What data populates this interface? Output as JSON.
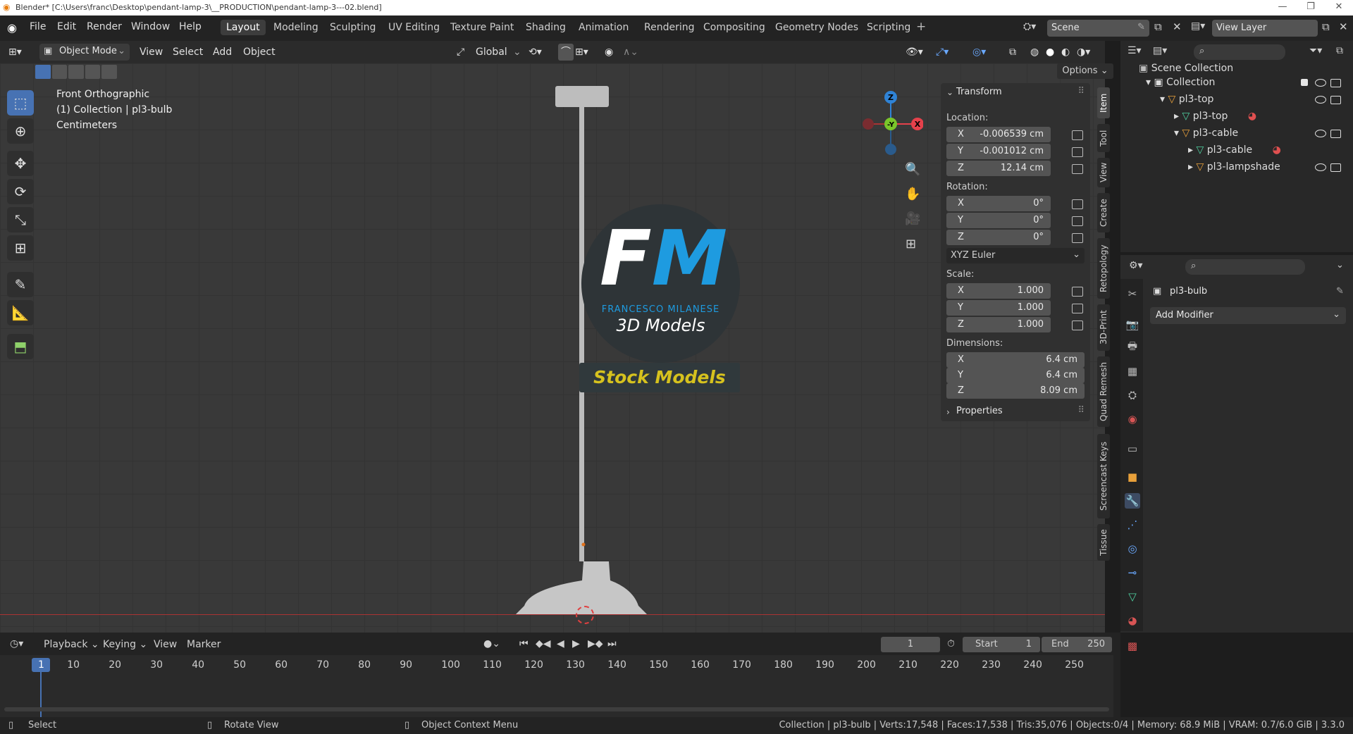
{
  "titlebar": {
    "title": "Blender* [C:\\Users\\franc\\Desktop\\pendant-lamp-3\\__PRODUCTION\\pendant-lamp-3---02.blend]"
  },
  "menu": [
    "File",
    "Edit",
    "Render",
    "Window",
    "Help"
  ],
  "workspaces": [
    "Layout",
    "Modeling",
    "Sculpting",
    "UV Editing",
    "Texture Paint",
    "Shading",
    "Animation",
    "Rendering",
    "Compositing",
    "Geometry Nodes",
    "Scripting"
  ],
  "active_workspace": "Layout",
  "scene": {
    "name": "Scene",
    "view_layer": "View Layer"
  },
  "header": {
    "mode": "Object Mode",
    "view": "View",
    "select": "Select",
    "add": "Add",
    "object": "Object",
    "orientation": "Global",
    "options": "Options"
  },
  "viewport": {
    "view_name": "Front Orthographic",
    "collection": "(1) Collection | pl3-bulb",
    "units": "Centimeters"
  },
  "watermark": {
    "brand": "FM",
    "name": "FRANCESCO MILANESE",
    "line2": "3D Models",
    "banner": "Stock Models"
  },
  "npanel": {
    "transform_title": "Transform",
    "location_label": "Location:",
    "location": [
      {
        "axis": "X",
        "value": "-0.006539 cm"
      },
      {
        "axis": "Y",
        "value": "-0.001012 cm"
      },
      {
        "axis": "Z",
        "value": "12.14 cm"
      }
    ],
    "rotation_label": "Rotation:",
    "rotation": [
      {
        "axis": "X",
        "value": "0°"
      },
      {
        "axis": "Y",
        "value": "0°"
      },
      {
        "axis": "Z",
        "value": "0°"
      }
    ],
    "rotation_mode": "XYZ Euler",
    "scale_label": "Scale:",
    "scale": [
      {
        "axis": "X",
        "value": "1.000"
      },
      {
        "axis": "Y",
        "value": "1.000"
      },
      {
        "axis": "Z",
        "value": "1.000"
      }
    ],
    "dimensions_label": "Dimensions:",
    "dimensions": [
      {
        "axis": "X",
        "value": "6.4 cm"
      },
      {
        "axis": "Y",
        "value": "6.4 cm"
      },
      {
        "axis": "Z",
        "value": "8.09 cm"
      }
    ],
    "properties_label": "Properties"
  },
  "side_tabs": [
    "Item",
    "Tool",
    "View",
    "Create",
    "Retopology",
    "3D-Print",
    "Quad Remesh",
    "Screencast Keys",
    "Tissue"
  ],
  "outliner": {
    "root": "Scene Collection",
    "items": [
      {
        "label": "Collection"
      },
      {
        "label": "pl3-top"
      },
      {
        "label": "pl3-top"
      },
      {
        "label": "pl3-cable"
      },
      {
        "label": "pl3-cable"
      },
      {
        "label": "pl3-lampshade"
      }
    ]
  },
  "properties": {
    "object_name": "pl3-bulb",
    "add_modifier": "Add Modifier"
  },
  "timeline": {
    "playback": "Playback",
    "keying": "Keying",
    "view": "View",
    "marker": "Marker",
    "current_frame": "1",
    "start_label": "Start",
    "start": "1",
    "end_label": "End",
    "end": "250",
    "ticks": [
      "1",
      "10",
      "20",
      "30",
      "40",
      "50",
      "60",
      "70",
      "80",
      "90",
      "100",
      "110",
      "120",
      "130",
      "140",
      "150",
      "160",
      "170",
      "180",
      "190",
      "200",
      "210",
      "220",
      "230",
      "240",
      "250"
    ]
  },
  "status": {
    "select": "Select",
    "rotate": "Rotate View",
    "context": "Object Context Menu",
    "info": "Collection | pl3-bulb | Verts:17,548 | Faces:17,538 | Tris:35,076 | Objects:0/4 | Memory: 68.9 MiB | VRAM: 0.7/6.0 GiB | 3.3.0"
  },
  "colors": {
    "accent": "#4772b3",
    "brand_blue": "#1e9be0",
    "banner_yellow": "#d6c21e",
    "axis_x": "#e5414b",
    "axis_y": "#7ac52a",
    "axis_z": "#2f83d6"
  }
}
